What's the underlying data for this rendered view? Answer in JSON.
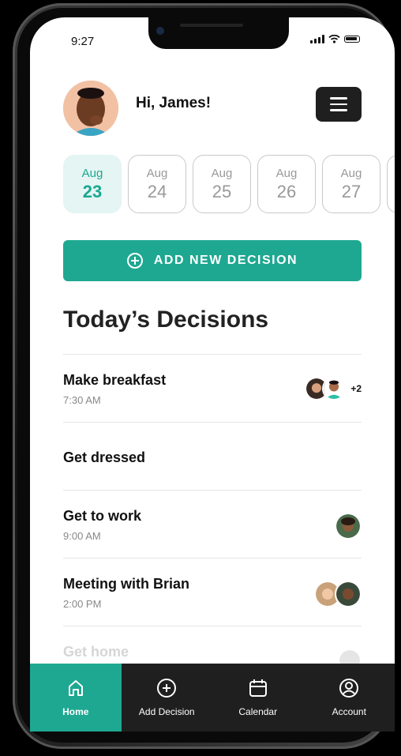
{
  "status": {
    "time": "9:27"
  },
  "header": {
    "greeting": "Hi, James!"
  },
  "dates": [
    {
      "month": "Aug",
      "day": "23",
      "active": true
    },
    {
      "month": "Aug",
      "day": "24"
    },
    {
      "month": "Aug",
      "day": "25"
    },
    {
      "month": "Aug",
      "day": "26"
    },
    {
      "month": "Aug",
      "day": "27"
    }
  ],
  "add_button": {
    "label": "ADD NEW DECISION"
  },
  "section": {
    "title": "Today’s Decisions"
  },
  "decisions": [
    {
      "title": "Make breakfast",
      "time": "7:30 AM",
      "extra": "+2"
    },
    {
      "title": "Get dressed"
    },
    {
      "title": "Get to work",
      "time": "9:00 AM"
    },
    {
      "title": "Meeting with Brian",
      "time": "2:00 PM"
    },
    {
      "title": "Get home"
    }
  ],
  "nav": {
    "home": "Home",
    "add": "Add Decision",
    "calendar": "Calendar",
    "account": "Account"
  },
  "colors": {
    "accent": "#1ea891",
    "accent_light": "#e4f5f3",
    "nav_bg": "#1f1f1f"
  }
}
